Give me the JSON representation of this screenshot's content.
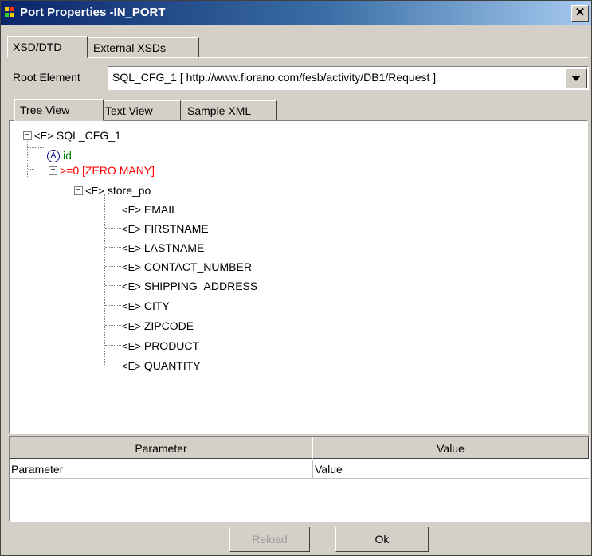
{
  "window": {
    "title": "Port Properties -IN_PORT",
    "close_glyph": "✕"
  },
  "outer_tabs": [
    {
      "label": "XSD/DTD",
      "active": true
    },
    {
      "label": "External XSDs",
      "active": false
    }
  ],
  "root_element": {
    "label": "Root Element",
    "value": "SQL_CFG_1 [ http://www.fiorano.com/fesb/activity/DB1/Request ]"
  },
  "inner_tabs": [
    {
      "label": "Tree View",
      "active": true
    },
    {
      "label": "Text View",
      "active": false
    },
    {
      "label": "Sample XML",
      "active": false
    }
  ],
  "tree": {
    "root": {
      "tag": "<E>",
      "name": "SQL_CFG_1"
    },
    "attribute": {
      "tag": "A",
      "name": "id",
      "color": "#008000"
    },
    "group": {
      "tag": ">=0",
      "name": "[ZERO MANY]",
      "color": "#ff0000"
    },
    "child": {
      "tag": "<E>",
      "name": "store_po"
    },
    "leaves": [
      {
        "tag": "<E>",
        "name": "EMAIL"
      },
      {
        "tag": "<E>",
        "name": "FIRSTNAME"
      },
      {
        "tag": "<E>",
        "name": "LASTNAME"
      },
      {
        "tag": "<E>",
        "name": "CONTACT_NUMBER"
      },
      {
        "tag": "<E>",
        "name": "SHIPPING_ADDRESS"
      },
      {
        "tag": "<E>",
        "name": "CITY"
      },
      {
        "tag": "<E>",
        "name": "ZIPCODE"
      },
      {
        "tag": "<E>",
        "name": "PRODUCT"
      },
      {
        "tag": "<E>",
        "name": "QUANTITY"
      }
    ],
    "expander_minus": "−"
  },
  "table": {
    "headers": [
      "Parameter",
      "Value"
    ],
    "rows": [
      [
        "Parameter",
        "Value"
      ]
    ]
  },
  "buttons": {
    "reload": "Reload",
    "ok": "Ok"
  },
  "colors": {
    "title_start": "#0a246a",
    "title_end": "#a6caf0",
    "face": "#d4d0c8"
  }
}
